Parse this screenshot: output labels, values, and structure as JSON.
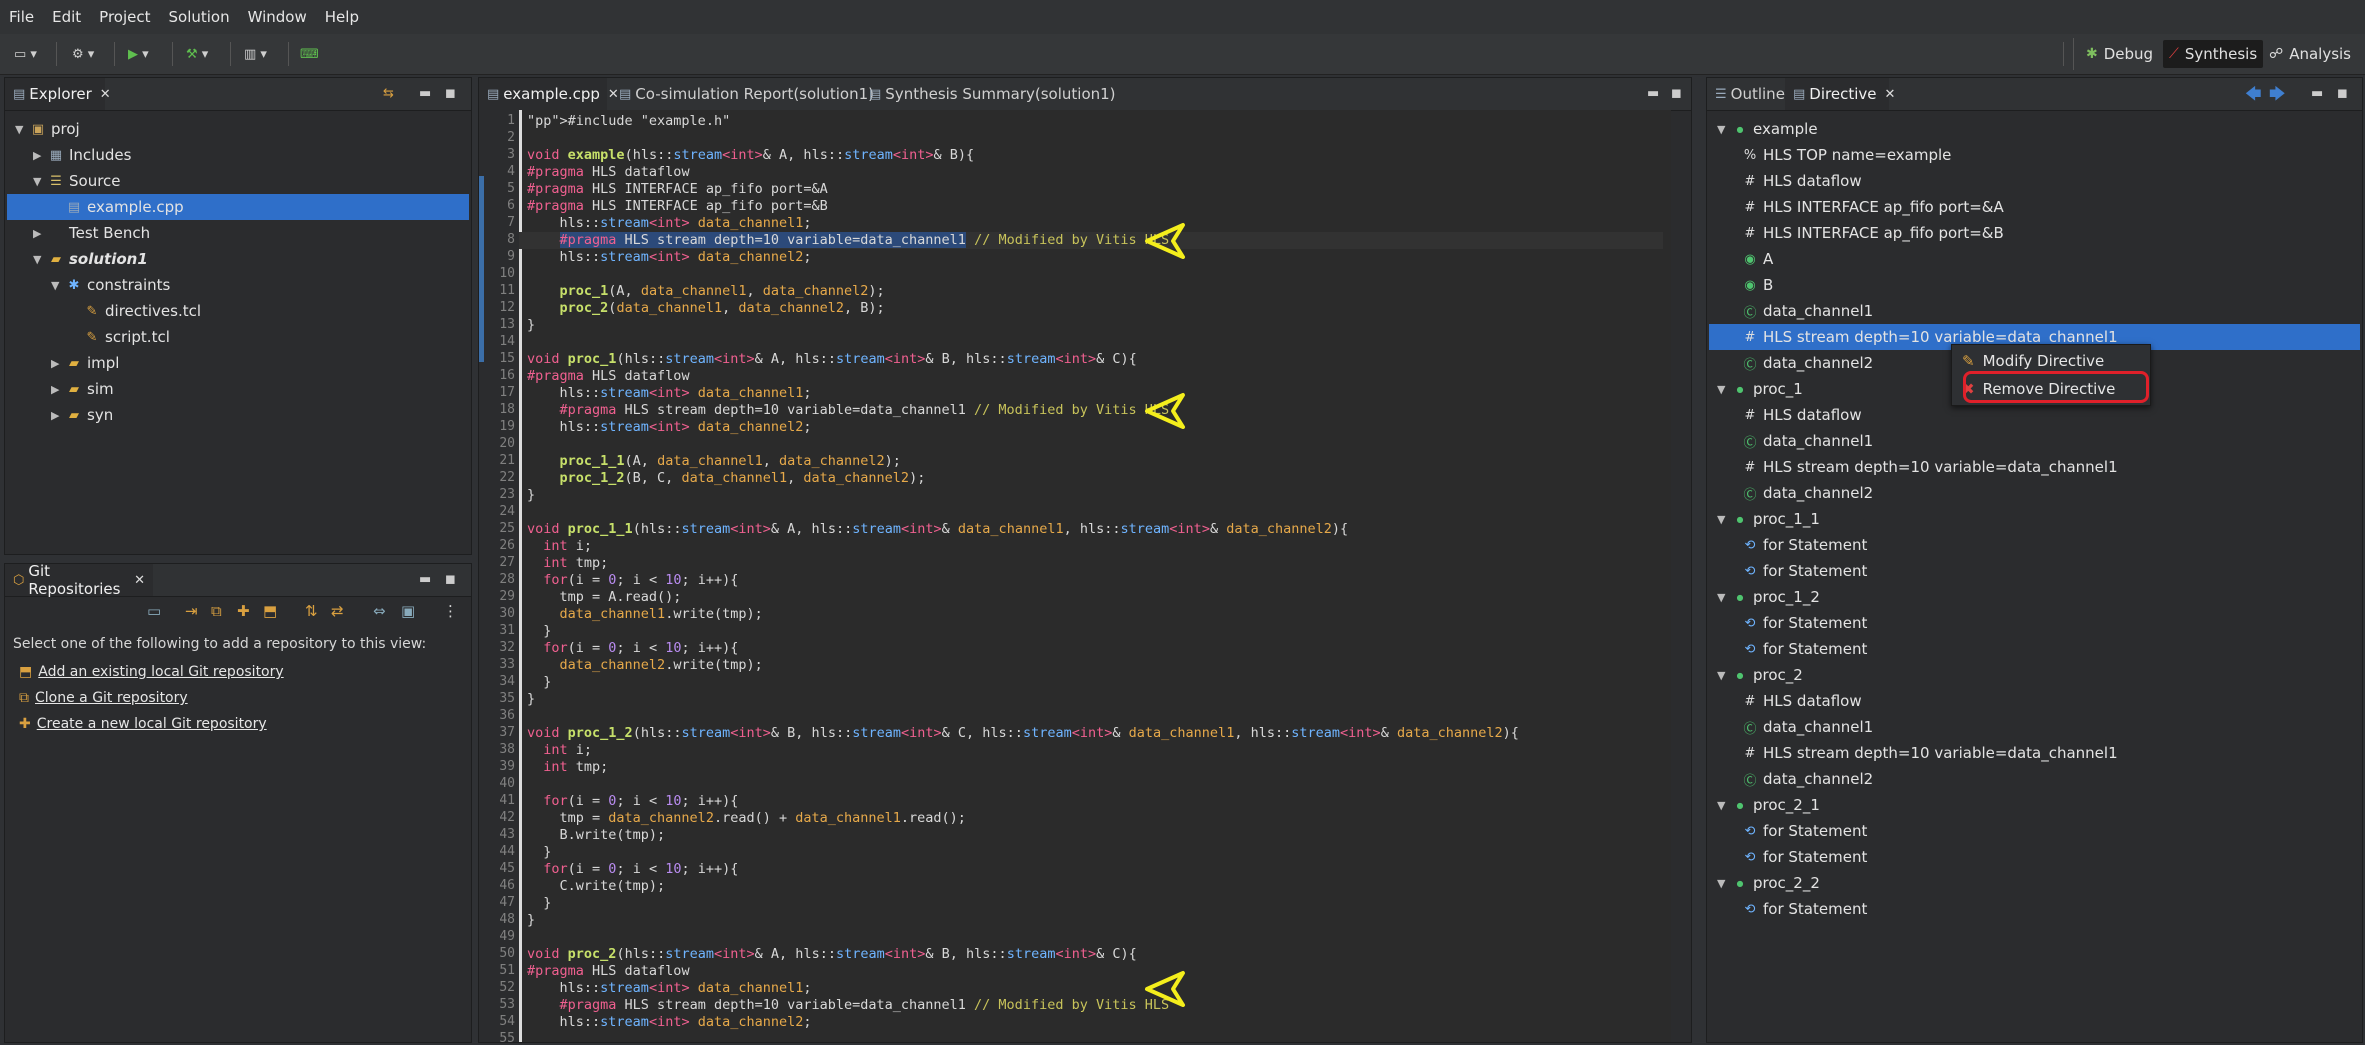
{
  "menu": [
    "File",
    "Edit",
    "Project",
    "Solution",
    "Window",
    "Help"
  ],
  "perspectives": {
    "debug": "Debug",
    "synthesis": "Synthesis",
    "analysis": "Analysis"
  },
  "explorer": {
    "tab": "Explorer",
    "items": [
      {
        "label": "proj",
        "level": 0,
        "icon": "project-icon",
        "twisty": "open"
      },
      {
        "label": "Includes",
        "level": 1,
        "icon": "includes-icon",
        "twisty": "closed"
      },
      {
        "label": "Source",
        "level": 1,
        "icon": "source-folder-icon",
        "twisty": "open"
      },
      {
        "label": "example.cpp",
        "level": 2,
        "icon": "cpp-file-icon",
        "twisty": "none",
        "selected": true
      },
      {
        "label": "Test Bench",
        "level": 1,
        "icon": "testbench-icon",
        "twisty": "closed"
      },
      {
        "label": "solution1",
        "level": 1,
        "icon": "solution-folder-icon",
        "twisty": "open",
        "bold": true
      },
      {
        "label": "constraints",
        "level": 2,
        "icon": "constraints-icon",
        "twisty": "open"
      },
      {
        "label": "directives.tcl",
        "level": 3,
        "icon": "tcl-file-icon",
        "twisty": "none"
      },
      {
        "label": "script.tcl",
        "level": 3,
        "icon": "tcl-file-icon",
        "twisty": "none"
      },
      {
        "label": "impl",
        "level": 2,
        "icon": "folder-icon",
        "twisty": "closed"
      },
      {
        "label": "sim",
        "level": 2,
        "icon": "folder-icon",
        "twisty": "closed"
      },
      {
        "label": "syn",
        "level": 2,
        "icon": "folder-icon",
        "twisty": "closed"
      }
    ]
  },
  "git": {
    "tab": "Git Repositories",
    "prompt": "Select one of the following to add a repository to this view:",
    "links": [
      "Add an existing local Git repository",
      "Clone a Git repository",
      "Create a new local Git repository"
    ]
  },
  "editor": {
    "tabs": [
      "example.cpp",
      "Co-simulation Report(solution1)",
      "Synthesis Summary(solution1)"
    ],
    "code": [
      "#include \"example.h\"",
      "",
      "void example(hls::stream<int>& A, hls::stream<int>& B){",
      "#pragma HLS dataflow",
      "#pragma HLS INTERFACE ap_fifo port=&A",
      "#pragma HLS INTERFACE ap_fifo port=&B",
      "    hls::stream<int> data_channel1;",
      "    #pragma HLS stream depth=10 variable=data_channel1 // Modified by Vitis HLS",
      "    hls::stream<int> data_channel2;",
      "",
      "    proc_1(A, data_channel1, data_channel2);",
      "    proc_2(data_channel1, data_channel2, B);",
      "}",
      "",
      "void proc_1(hls::stream<int>& A, hls::stream<int>& B, hls::stream<int>& C){",
      "#pragma HLS dataflow",
      "    hls::stream<int> data_channel1;",
      "    #pragma HLS stream depth=10 variable=data_channel1 // Modified by Vitis HLS",
      "    hls::stream<int> data_channel2;",
      "",
      "    proc_1_1(A, data_channel1, data_channel2);",
      "    proc_1_2(B, C, data_channel1, data_channel2);",
      "}",
      "",
      "void proc_1_1(hls::stream<int>& A, hls::stream<int>& data_channel1, hls::stream<int>& data_channel2){",
      "  int i;",
      "  int tmp;",
      "  for(i = 0; i < 10; i++){",
      "    tmp = A.read();",
      "    data_channel1.write(tmp);",
      "  }",
      "  for(i = 0; i < 10; i++){",
      "    data_channel2.write(tmp);",
      "  }",
      "}",
      "",
      "void proc_1_2(hls::stream<int>& B, hls::stream<int>& C, hls::stream<int>& data_channel1, hls::stream<int>& data_channel2){",
      "  int i;",
      "  int tmp;",
      "",
      "  for(i = 0; i < 10; i++){",
      "    tmp = data_channel2.read() + data_channel1.read();",
      "    B.write(tmp);",
      "  }",
      "  for(i = 0; i < 10; i++){",
      "    C.write(tmp);",
      "  }",
      "}",
      "",
      "void proc_2(hls::stream<int>& A, hls::stream<int>& B, hls::stream<int>& C){",
      "#pragma HLS dataflow",
      "    hls::stream<int> data_channel1;",
      "    #pragma HLS stream depth=10 variable=data_channel1 // Modified by Vitis HLS",
      "    hls::stream<int> data_channel2;",
      ""
    ]
  },
  "outline_tab": "Outline",
  "directive": {
    "tab": "Directive",
    "items": [
      {
        "label": "example",
        "level": 0,
        "icon": "function-icon",
        "twisty": "open"
      },
      {
        "label": "HLS TOP name=example",
        "level": 1,
        "icon": "top-directive-icon"
      },
      {
        "label": "HLS dataflow",
        "level": 1,
        "icon": "hash-icon"
      },
      {
        "label": "HLS INTERFACE ap_fifo port=&A",
        "level": 1,
        "icon": "hash-icon"
      },
      {
        "label": "HLS INTERFACE ap_fifo port=&B",
        "level": 1,
        "icon": "hash-icon"
      },
      {
        "label": "A",
        "level": 1,
        "icon": "port-icon"
      },
      {
        "label": "B",
        "level": 1,
        "icon": "port-icon"
      },
      {
        "label": "data_channel1",
        "level": 1,
        "icon": "variable-icon"
      },
      {
        "label": "HLS stream depth=10 variable=data_channel1",
        "level": 1,
        "icon": "hash-icon",
        "selected": true
      },
      {
        "label": "data_channel2",
        "level": 1,
        "icon": "variable-icon"
      },
      {
        "label": "proc_1",
        "level": 0,
        "icon": "function-icon",
        "twisty": "open"
      },
      {
        "label": "HLS dataflow",
        "level": 1,
        "icon": "hash-icon"
      },
      {
        "label": "data_channel1",
        "level": 1,
        "icon": "variable-icon"
      },
      {
        "label": "HLS stream depth=10 variable=data_channel1",
        "level": 1,
        "icon": "hash-icon"
      },
      {
        "label": "data_channel2",
        "level": 1,
        "icon": "variable-icon"
      },
      {
        "label": "proc_1_1",
        "level": 0,
        "icon": "function-icon",
        "twisty": "open"
      },
      {
        "label": "for Statement",
        "level": 1,
        "icon": "loop-icon"
      },
      {
        "label": "for Statement",
        "level": 1,
        "icon": "loop-icon"
      },
      {
        "label": "proc_1_2",
        "level": 0,
        "icon": "function-icon",
        "twisty": "open"
      },
      {
        "label": "for Statement",
        "level": 1,
        "icon": "loop-icon"
      },
      {
        "label": "for Statement",
        "level": 1,
        "icon": "loop-icon"
      },
      {
        "label": "proc_2",
        "level": 0,
        "icon": "function-icon",
        "twisty": "open"
      },
      {
        "label": "HLS dataflow",
        "level": 1,
        "icon": "hash-icon"
      },
      {
        "label": "data_channel1",
        "level": 1,
        "icon": "variable-icon"
      },
      {
        "label": "HLS stream depth=10 variable=data_channel1",
        "level": 1,
        "icon": "hash-icon"
      },
      {
        "label": "data_channel2",
        "level": 1,
        "icon": "variable-icon"
      },
      {
        "label": "proc_2_1",
        "level": 0,
        "icon": "function-icon",
        "twisty": "open"
      },
      {
        "label": "for Statement",
        "level": 1,
        "icon": "loop-icon"
      },
      {
        "label": "for Statement",
        "level": 1,
        "icon": "loop-icon"
      },
      {
        "label": "proc_2_2",
        "level": 0,
        "icon": "function-icon",
        "twisty": "open"
      },
      {
        "label": "for Statement",
        "level": 1,
        "icon": "loop-icon"
      }
    ]
  },
  "context_menu": {
    "modify": "Modify Directive",
    "remove": "Remove Directive"
  },
  "colors": {
    "selection": "#2f6fc9",
    "highlight_ring": "#e0202a",
    "arrow": "#f4ee1c"
  }
}
